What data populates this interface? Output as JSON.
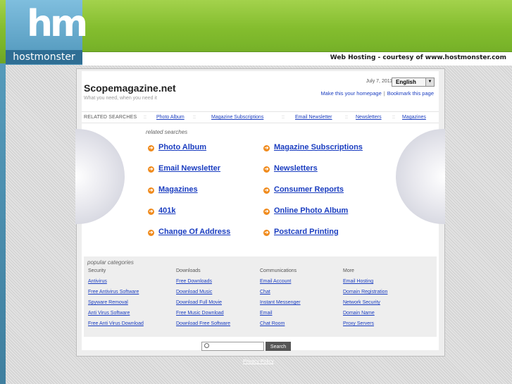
{
  "header": {
    "logo_mark": "hm",
    "logo_text": "hostmonster",
    "tagline": "Web Hosting - courtesy of www.hostmonster.com"
  },
  "site": {
    "title": "Scopemagazine.net",
    "tagline": "What you need, when you need it",
    "date": "July 7, 2011",
    "language": "English",
    "make_homepage": "Make this your homepage",
    "bookmark": "Bookmark this page"
  },
  "related_bar": {
    "label": "RELATED SEARCHES",
    "links": [
      "Photo Album",
      "Magazine Subscriptions",
      "Email Newsletter",
      "Newsletters",
      "Magazines"
    ]
  },
  "related": {
    "heading": "related searches",
    "items": [
      "Photo Album",
      "Magazine Subscriptions",
      "Email Newsletter",
      "Newsletters",
      "Magazines",
      "Consumer Reports",
      "401k",
      "Online Photo Album",
      "Change Of Address",
      "Postcard Printing"
    ]
  },
  "popular": {
    "heading": "popular categories",
    "columns": [
      {
        "title": "Security",
        "links": [
          "Antivirus",
          "Free Antivirus Software",
          "Spyware Removal",
          "Anti Virus Software",
          "Free Anti Virus Download"
        ]
      },
      {
        "title": "Downloads",
        "links": [
          "Free Downloads",
          "Download Music",
          "Download Full Movie",
          "Free Music Download",
          "Download Free Software"
        ]
      },
      {
        "title": "Communications",
        "links": [
          "Email Account",
          "Chat",
          "Instant Messenger",
          "Email",
          "Chat Room"
        ]
      },
      {
        "title": "More",
        "links": [
          "Email Hosting",
          "Domain Registration",
          "Network Security",
          "Domain Name",
          "Proxy Servers"
        ]
      }
    ]
  },
  "search": {
    "button": "Search",
    "placeholder": ""
  },
  "footer": {
    "privacy": "Privacy Policy"
  },
  "colors": {
    "accent_green": "#84bd2e",
    "link_blue": "#1a3dc0",
    "bullet_orange": "#f08b1d"
  }
}
